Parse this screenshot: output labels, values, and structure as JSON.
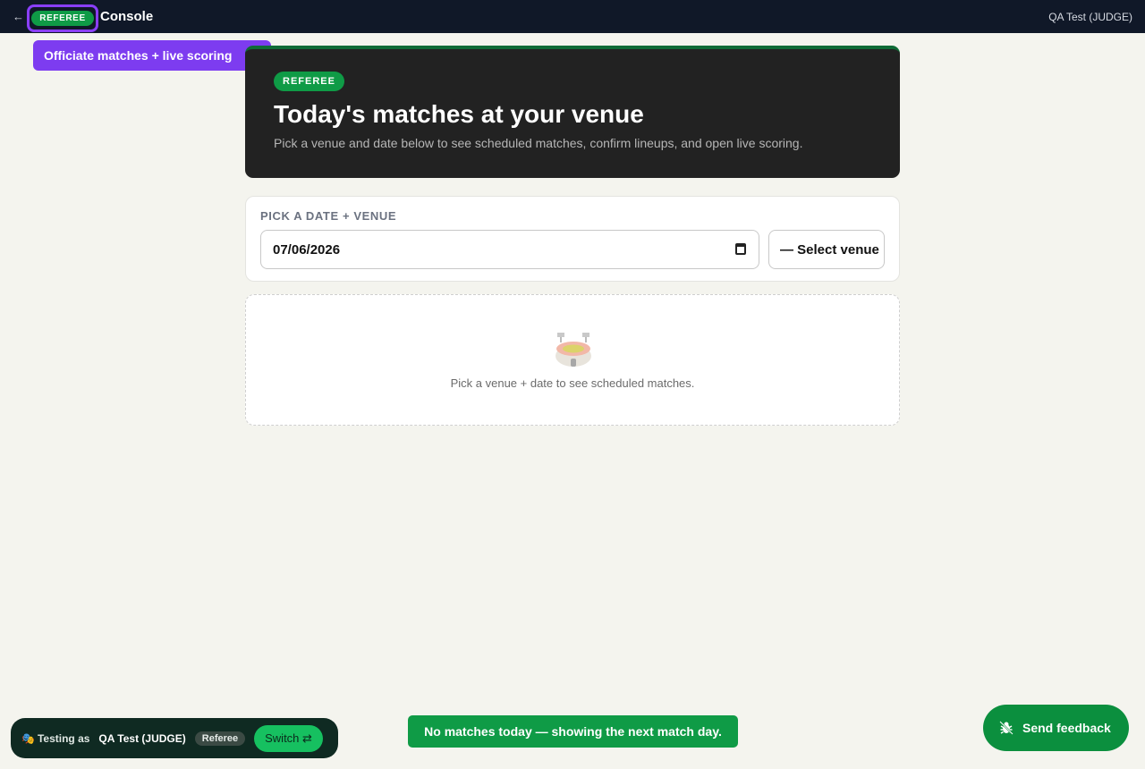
{
  "topbar": {
    "back_icon": "←",
    "role_badge": "REFEREE",
    "title": "Console",
    "user": "QA Test (JUDGE)"
  },
  "tooltip": {
    "text": "Officiate matches + live scoring"
  },
  "hero": {
    "badge": "REFEREE",
    "title": "Today's matches at your venue",
    "subtitle": "Pick a venue and date below to see scheduled matches, confirm lineups, and open live scoring."
  },
  "picker": {
    "label": "PICK A DATE + VENUE",
    "date_value": "07/06/2026",
    "venue_value": "— Select venue"
  },
  "empty_state": {
    "icon": "stadium-icon",
    "text": "Pick a venue + date to see scheduled matches."
  },
  "testing_bar": {
    "icon": "🎭",
    "label": "Testing as",
    "user": "QA Test (JUDGE)",
    "role": "Referee",
    "switch_label": "Switch ⇄"
  },
  "toast": {
    "text": "No matches today — showing the next match day."
  },
  "feedback": {
    "label": "Send feedback"
  },
  "colors": {
    "brand_green": "#0f9b46",
    "accent_purple": "#7d3cf0",
    "topbar": "#101828"
  }
}
